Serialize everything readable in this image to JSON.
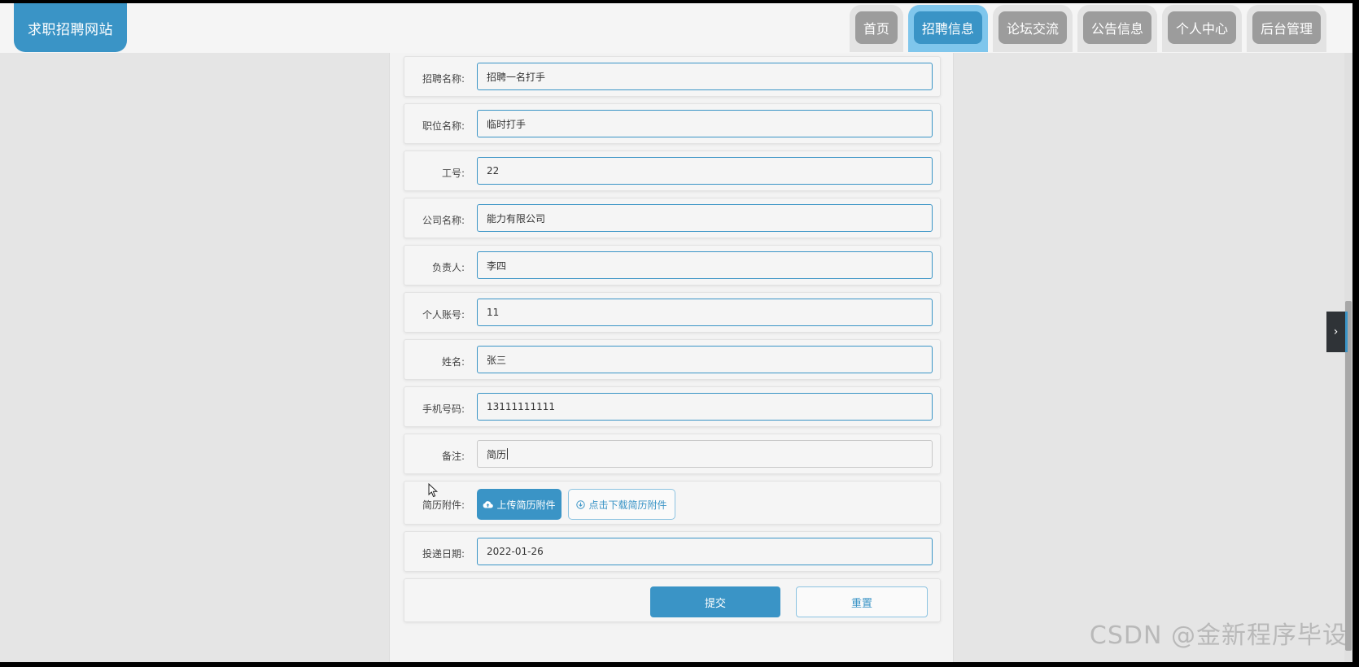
{
  "header": {
    "logo": "求职招聘网站",
    "nav": [
      {
        "label": "首页",
        "active": false
      },
      {
        "label": "招聘信息",
        "active": true
      },
      {
        "label": "论坛交流",
        "active": false
      },
      {
        "label": "公告信息",
        "active": false
      },
      {
        "label": "个人中心",
        "active": false
      },
      {
        "label": "后台管理",
        "active": false
      }
    ]
  },
  "form": {
    "recruit_name": {
      "label": "招聘名称:",
      "value": "招聘一名打手"
    },
    "position_name": {
      "label": "职位名称:",
      "value": "临时打手"
    },
    "job_number": {
      "label": "工号:",
      "value": "22"
    },
    "company_name": {
      "label": "公司名称:",
      "value": "能力有限公司"
    },
    "person_in_charge": {
      "label": "负责人:",
      "value": "李四"
    },
    "personal_account": {
      "label": "个人账号:",
      "value": "11"
    },
    "name": {
      "label": "姓名:",
      "value": "张三"
    },
    "phone": {
      "label": "手机号码:",
      "value": "13111111111"
    },
    "remark": {
      "label": "备注:",
      "value": "简历"
    },
    "resume_attachment": {
      "label": "简历附件:",
      "upload_label": "上传简历附件",
      "download_label": "点击下载简历附件"
    },
    "submit_date": {
      "label": "投递日期:",
      "value": "2022-01-26"
    },
    "submit_label": "提交",
    "reset_label": "重置"
  },
  "watermark": "CSDN @金新程序毕设",
  "colors": {
    "accent": "#3a94c6",
    "nav_inactive": "#9c9c9c",
    "background": "#e5e5e5"
  },
  "icons": {
    "upload": "cloud-upload-icon",
    "download": "download-circle-icon",
    "side_toggle": "chevron-right-icon"
  }
}
